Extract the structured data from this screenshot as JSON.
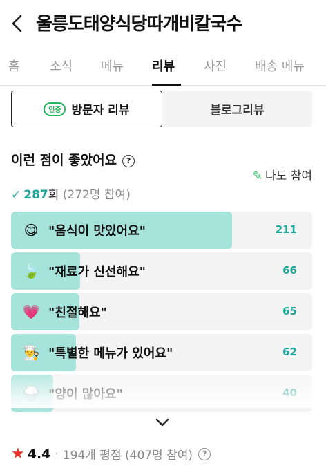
{
  "header": {
    "title": "울릉도태양식당따개비칼국수"
  },
  "tabs": [
    "홈",
    "소식",
    "메뉴",
    "리뷰",
    "사진",
    "배송 메뉴"
  ],
  "active_tab": "리뷰",
  "review_type": {
    "visitor_badge": "인증",
    "visitor": "방문자 리뷰",
    "blog": "블로그리뷰"
  },
  "likes": {
    "title": "이런 점이 좋았어요",
    "help": "?",
    "me_too": "나도 참여",
    "count": "287",
    "count_unit": "회",
    "participants": "(272명 참여)"
  },
  "keywords": [
    {
      "icon": "yum-face-icon",
      "emoji": "😋",
      "label": "\"음식이 맛있어요\"",
      "count": "211",
      "ratio": 0.735
    },
    {
      "icon": "leaf-icon",
      "emoji": "🍃",
      "label": "\"재료가 신선해요\"",
      "count": "66",
      "ratio": 0.23
    },
    {
      "icon": "heart-face-icon",
      "emoji": "💗",
      "label": "\"친절해요\"",
      "count": "65",
      "ratio": 0.226
    },
    {
      "icon": "chef-icon",
      "emoji": "👨‍🍳",
      "label": "\"특별한 메뉴가 있어요\"",
      "count": "62",
      "ratio": 0.216
    },
    {
      "icon": "bowl-icon",
      "emoji": "🍚",
      "label": "\"양이 많아요\"",
      "count": "40",
      "ratio": 0.139
    }
  ],
  "rating": {
    "score": "4.4",
    "count": "194개 평점",
    "participants": "(407명 참여)"
  },
  "colors": {
    "accent": "#20a59a",
    "fill": "#a6e3da",
    "star": "#e5332a",
    "cert": "#25b35b"
  }
}
